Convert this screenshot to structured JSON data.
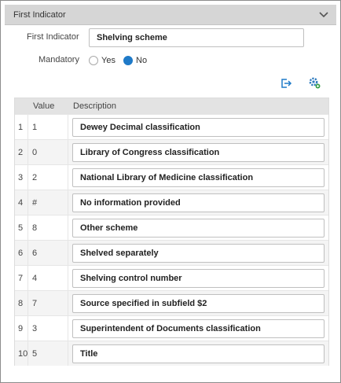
{
  "header": {
    "title": "First Indicator"
  },
  "form": {
    "name_label": "First Indicator",
    "name_value": "Shelving scheme",
    "mandatory_label": "Mandatory",
    "mandatory_options": [
      {
        "label": "Yes",
        "selected": false
      },
      {
        "label": "No",
        "selected": true
      }
    ],
    "accent_color": "#1f7ac8"
  },
  "toolbar": {
    "icons": [
      "export-icon",
      "settings-icon"
    ]
  },
  "table": {
    "columns": [
      "Value",
      "Description"
    ],
    "rows": [
      {
        "index": "1",
        "value": "1",
        "description": "Dewey Decimal classification"
      },
      {
        "index": "2",
        "value": "0",
        "description": "Library of Congress classification"
      },
      {
        "index": "3",
        "value": "2",
        "description": "National Library of Medicine classification"
      },
      {
        "index": "4",
        "value": "#",
        "description": "No information provided"
      },
      {
        "index": "5",
        "value": "8",
        "description": "Other scheme"
      },
      {
        "index": "6",
        "value": "6",
        "description": "Shelved separately"
      },
      {
        "index": "7",
        "value": "4",
        "description": "Shelving control number"
      },
      {
        "index": "8",
        "value": "7",
        "description": "Source specified in subfield $2"
      },
      {
        "index": "9",
        "value": "3",
        "description": "Superintendent of Documents classification"
      },
      {
        "index": "10",
        "value": "5",
        "description": "Title"
      }
    ]
  }
}
